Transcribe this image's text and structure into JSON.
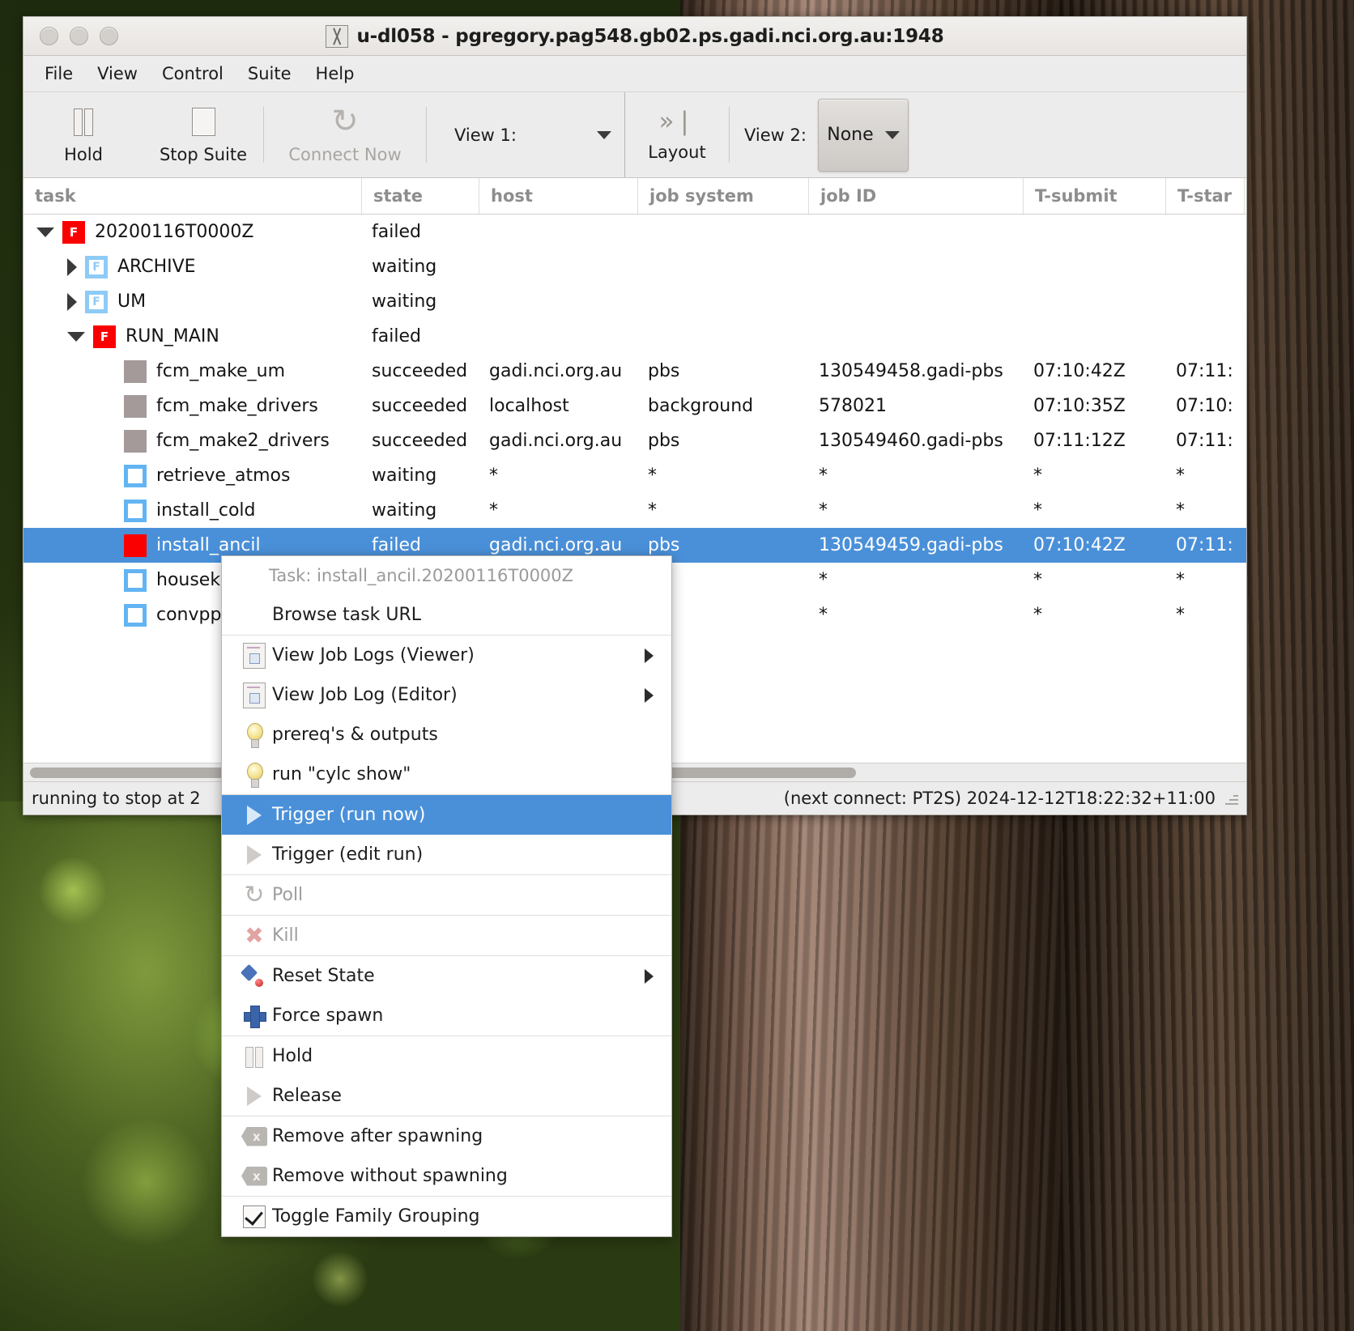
{
  "window": {
    "title": "u-dl058 - pgregory.pag548.gb02.ps.gadi.nci.org.au:1948",
    "app_icon": "x-logo-icon"
  },
  "menubar": {
    "items": [
      "File",
      "View",
      "Control",
      "Suite",
      "Help"
    ]
  },
  "toolbar": {
    "hold_label": "Hold",
    "stop_label": "Stop Suite",
    "connect_label": "Connect Now",
    "view1_label": "View 1:",
    "layout_label": "Layout",
    "view2_label": "View 2:",
    "view2_value": "None"
  },
  "table": {
    "columns": [
      "task",
      "state",
      "host",
      "job system",
      "job ID",
      "T-submit",
      "T-star"
    ],
    "rows": [
      {
        "indent": 0,
        "expander": "down",
        "icon": "failed",
        "icon_letter": "F",
        "task": "20200116T0000Z",
        "state": "failed",
        "host": "",
        "job_system": "",
        "job_id": "",
        "t_submit": "",
        "t_start": "",
        "selected": false
      },
      {
        "indent": 1,
        "expander": "right",
        "icon": "family-wait",
        "icon_letter": "F",
        "task": "ARCHIVE",
        "state": "waiting",
        "host": "",
        "job_system": "",
        "job_id": "",
        "t_submit": "",
        "t_start": "",
        "selected": false
      },
      {
        "indent": 1,
        "expander": "right",
        "icon": "family-wait",
        "icon_letter": "F",
        "task": "UM",
        "state": "waiting",
        "host": "",
        "job_system": "",
        "job_id": "",
        "t_submit": "",
        "t_start": "",
        "selected": false
      },
      {
        "indent": 1,
        "expander": "down",
        "icon": "failed",
        "icon_letter": "F",
        "task": "RUN_MAIN",
        "state": "failed",
        "host": "",
        "job_system": "",
        "job_id": "",
        "t_submit": "",
        "t_start": "",
        "selected": false
      },
      {
        "indent": 2,
        "expander": "none",
        "icon": "succeeded",
        "icon_letter": "",
        "task": "fcm_make_um",
        "state": "succeeded",
        "host": "gadi.nci.org.au",
        "job_system": "pbs",
        "job_id": "130549458.gadi-pbs",
        "t_submit": "07:10:42Z",
        "t_start": "07:11:",
        "selected": false
      },
      {
        "indent": 2,
        "expander": "none",
        "icon": "succeeded",
        "icon_letter": "",
        "task": "fcm_make_drivers",
        "state": "succeeded",
        "host": "localhost",
        "job_system": "background",
        "job_id": "578021",
        "t_submit": "07:10:35Z",
        "t_start": "07:10:",
        "selected": false
      },
      {
        "indent": 2,
        "expander": "none",
        "icon": "succeeded",
        "icon_letter": "",
        "task": "fcm_make2_drivers",
        "state": "succeeded",
        "host": "gadi.nci.org.au",
        "job_system": "pbs",
        "job_id": "130549460.gadi-pbs",
        "t_submit": "07:11:12Z",
        "t_start": "07:11:",
        "selected": false
      },
      {
        "indent": 2,
        "expander": "none",
        "icon": "waiting",
        "icon_letter": "",
        "task": "retrieve_atmos",
        "state": "waiting",
        "host": "*",
        "job_system": "*",
        "job_id": "*",
        "t_submit": "*",
        "t_start": "*",
        "selected": false
      },
      {
        "indent": 2,
        "expander": "none",
        "icon": "waiting",
        "icon_letter": "",
        "task": "install_cold",
        "state": "waiting",
        "host": "*",
        "job_system": "*",
        "job_id": "*",
        "t_submit": "*",
        "t_start": "*",
        "selected": false
      },
      {
        "indent": 2,
        "expander": "none",
        "icon": "failed",
        "icon_letter": "",
        "task": "install_ancil",
        "state": "failed",
        "host": "gadi.nci.org.au",
        "job_system": "pbs",
        "job_id": "130549459.gadi-pbs",
        "t_submit": "07:10:42Z",
        "t_start": "07:11:",
        "selected": true
      },
      {
        "indent": 2,
        "expander": "none",
        "icon": "waiting",
        "icon_letter": "",
        "task": "housek",
        "state": "",
        "host": "",
        "job_system": "",
        "job_id": "*",
        "t_submit": "*",
        "t_start": "*",
        "selected": false
      },
      {
        "indent": 2,
        "expander": "none",
        "icon": "waiting",
        "icon_letter": "",
        "task": "convpp",
        "state": "",
        "host": "",
        "job_system": "",
        "job_id": "*",
        "t_submit": "*",
        "t_start": "*",
        "selected": false
      }
    ]
  },
  "statusbar": {
    "left_text": "running to stop at 2",
    "right_text": "(next connect: PT2S)  2024-12-12T18:22:32+11:00"
  },
  "context_menu": {
    "header": "Task: install_ancil.20200116T0000Z",
    "items": [
      {
        "label": "Browse task URL",
        "icon": "none",
        "disabled": false,
        "highlight": false,
        "submenu": false,
        "sep_after": true
      },
      {
        "label": "View Job Logs (Viewer)",
        "icon": "document-icon",
        "disabled": false,
        "highlight": false,
        "submenu": true,
        "sep_after": false
      },
      {
        "label": "View Job Log (Editor)",
        "icon": "document-icon",
        "disabled": false,
        "highlight": false,
        "submenu": true,
        "sep_after": false
      },
      {
        "label": "prereq's & outputs",
        "icon": "lightbulb-icon",
        "disabled": false,
        "highlight": false,
        "submenu": false,
        "sep_after": false
      },
      {
        "label": "run \"cylc show\"",
        "icon": "lightbulb-icon",
        "disabled": false,
        "highlight": false,
        "submenu": false,
        "sep_after": true
      },
      {
        "label": "Trigger (run now)",
        "icon": "play-icon",
        "disabled": false,
        "highlight": true,
        "submenu": false,
        "sep_after": false
      },
      {
        "label": "Trigger (edit run)",
        "icon": "play-icon",
        "disabled": false,
        "highlight": false,
        "submenu": false,
        "sep_after": true
      },
      {
        "label": "Poll",
        "icon": "refresh-icon",
        "disabled": true,
        "highlight": false,
        "submenu": false,
        "sep_after": true
      },
      {
        "label": "Kill",
        "icon": "kill-icon",
        "disabled": true,
        "highlight": false,
        "submenu": false,
        "sep_after": true
      },
      {
        "label": "Reset State",
        "icon": "reset-icon",
        "disabled": false,
        "highlight": false,
        "submenu": true,
        "sep_after": false
      },
      {
        "label": "Force spawn",
        "icon": "plus-icon",
        "disabled": false,
        "highlight": false,
        "submenu": false,
        "sep_after": true
      },
      {
        "label": "Hold",
        "icon": "pause-icon",
        "disabled": false,
        "highlight": false,
        "submenu": false,
        "sep_after": false
      },
      {
        "label": "Release",
        "icon": "play-icon",
        "disabled": false,
        "highlight": false,
        "submenu": false,
        "sep_after": true
      },
      {
        "label": "Remove after spawning",
        "icon": "remove-icon",
        "disabled": false,
        "highlight": false,
        "submenu": false,
        "sep_after": false
      },
      {
        "label": "Remove without spawning",
        "icon": "remove-icon",
        "disabled": false,
        "highlight": false,
        "submenu": false,
        "sep_after": true
      },
      {
        "label": "Toggle Family Grouping",
        "icon": "checkbox-icon",
        "disabled": false,
        "highlight": false,
        "submenu": false,
        "sep_after": false
      }
    ]
  },
  "colors": {
    "selection": "#4a90d9",
    "failed": "#fb0000",
    "succeeded": "#a49a9a",
    "waiting_border": "#63b4f2",
    "family_border": "#8ecbf7"
  }
}
